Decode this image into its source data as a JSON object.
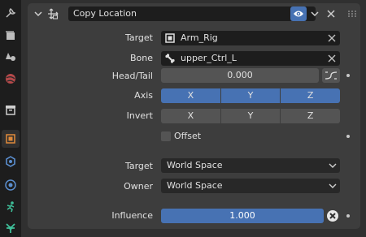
{
  "constraint": {
    "name": "Copy Location",
    "target_label": "Target",
    "target_value": "Arm_Rig",
    "bone_label": "Bone",
    "bone_value": "upper_Ctrl_L",
    "headtail_label": "Head/Tail",
    "headtail_value": "0.000",
    "axis_label": "Axis",
    "axis_buttons": [
      "X",
      "Y",
      "Z"
    ],
    "invert_label": "Invert",
    "invert_buttons": [
      "X",
      "Y",
      "Z"
    ],
    "offset_label": "Offset",
    "offset_checked": false,
    "target_space_label": "Target",
    "target_space_value": "World Space",
    "owner_space_label": "Owner",
    "owner_space_value": "World Space",
    "influence_label": "Influence",
    "influence_value": "1.000"
  },
  "colors": {
    "accent": "#4772b3",
    "panel": "#3d3d3d",
    "field": "#1d1d1d",
    "sidebar": "#1d1d1d"
  },
  "sidebar_icons": [
    "tool-icon",
    "render-icon",
    "output-icon",
    "view-layer-icon",
    "scene-icon",
    "world-icon",
    "collection-icon",
    "object-icon",
    "modifier-icon",
    "particles-icon",
    "physics-icon",
    "constraint-icon"
  ]
}
